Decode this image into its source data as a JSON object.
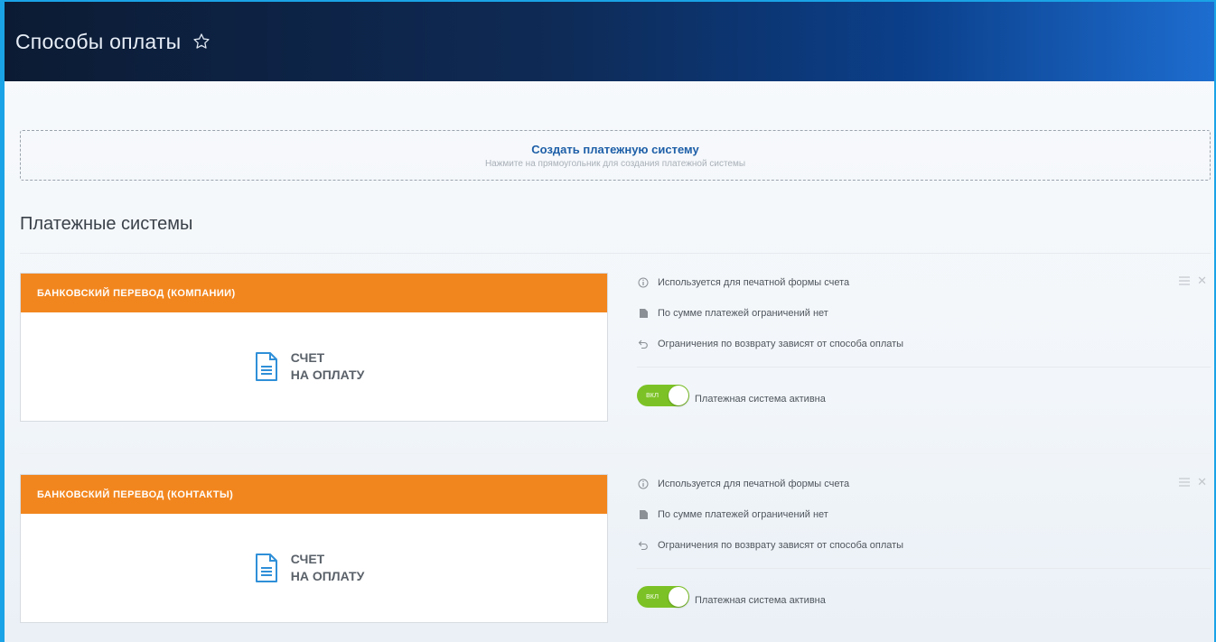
{
  "header": {
    "title": "Способы оплаты",
    "star_icon": "star-icon"
  },
  "create": {
    "title": "Создать платежную систему",
    "subtitle": "Нажмите на прямоугольник для создания платежной системы"
  },
  "section": {
    "title": "Платежные системы"
  },
  "payment_systems": [
    {
      "name": "БАНКОВСКИЙ ПЕРЕВОД (КОМПАНИИ)",
      "doc_line1": "СЧЕТ",
      "doc_line2": "НА ОПЛАТУ",
      "info": [
        {
          "icon": "info-icon",
          "text": "Используется для печатной формы счета"
        },
        {
          "icon": "document-icon",
          "text": "По сумме платежей ограничений нет"
        },
        {
          "icon": "return-icon",
          "text": "Ограничения по возврату зависят от способа оплаты"
        }
      ],
      "toggle_text": "вкл",
      "status": "Платежная система активна",
      "active": true
    },
    {
      "name": "БАНКОВСКИЙ ПЕРЕВОД (КОНТАКТЫ)",
      "doc_line1": "СЧЕТ",
      "doc_line2": "НА ОПЛАТУ",
      "info": [
        {
          "icon": "info-icon",
          "text": "Используется для печатной формы счета"
        },
        {
          "icon": "document-icon",
          "text": "По сумме платежей ограничений нет"
        },
        {
          "icon": "return-icon",
          "text": "Ограничения по возврату зависят от способа оплаты"
        }
      ],
      "toggle_text": "вкл",
      "status": "Платежная система активна",
      "active": true
    }
  ],
  "colors": {
    "header_bg_start": "#0c1b33",
    "header_bg_end": "#1d6dd0",
    "card_header": "#f2861e",
    "toggle_on": "#7cc226",
    "link": "#1e5fa8",
    "frame_border": "#1aa3e6"
  }
}
